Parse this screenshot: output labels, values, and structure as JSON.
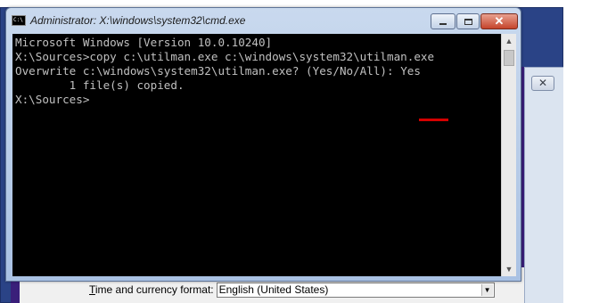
{
  "cmd_window": {
    "title": "Administrator: X:\\windows\\system32\\cmd.exe",
    "icon": "cmd-icon",
    "icon_text": "C:\\",
    "buttons": {
      "minimize": "minimize-icon",
      "maximize": "maximize-icon",
      "close": "close-icon",
      "close_glyph": "✕"
    },
    "console_lines": [
      "Microsoft Windows [Version 10.0.10240]",
      "",
      "",
      "X:\\Sources>copy c:\\utilman.exe c:\\windows\\system32\\utilman.exe",
      "Overwrite c:\\windows\\system32\\utilman.exe? (Yes/No/All): ",
      "        1 file(s) copied.",
      "",
      "X:\\Sources>"
    ],
    "overwrite_answer": "Yes",
    "highlight_color": "#d40000",
    "scroll_up": "▲",
    "scroll_down": "▼"
  },
  "background": {
    "close_glyph": "✕",
    "time_label_prefix": "T",
    "time_label_rest": "ime and currency format:",
    "time_value": "English (United States)",
    "dropdown_arrow": "▼"
  }
}
